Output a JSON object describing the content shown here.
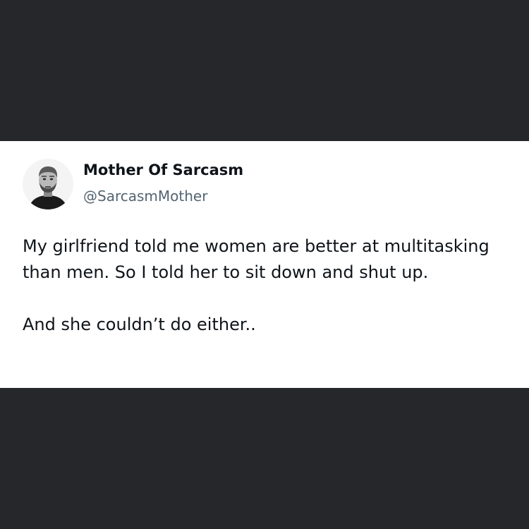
{
  "tweet": {
    "author_name": "Mother Of Sarcasm",
    "author_handle": "@SarcasmMother",
    "paragraphs": [
      "My girlfriend told me women are better at multitasking than men. So I told her to sit down and shut up.",
      "And she couldn’t do either.."
    ]
  },
  "colors": {
    "background": "#26272a",
    "card": "#ffffff",
    "text": "#0f1419",
    "handle": "#536471"
  }
}
